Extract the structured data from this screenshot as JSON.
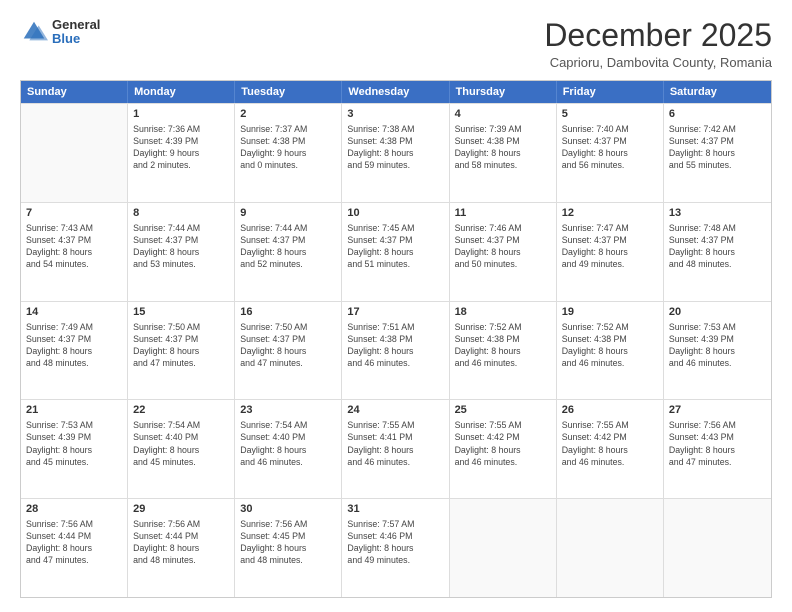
{
  "logo": {
    "general": "General",
    "blue": "Blue"
  },
  "header": {
    "month": "December 2025",
    "location": "Caprioru, Dambovita County, Romania"
  },
  "days": [
    "Sunday",
    "Monday",
    "Tuesday",
    "Wednesday",
    "Thursday",
    "Friday",
    "Saturday"
  ],
  "weeks": [
    [
      {
        "date": "",
        "info": ""
      },
      {
        "date": "1",
        "info": "Sunrise: 7:36 AM\nSunset: 4:39 PM\nDaylight: 9 hours\nand 2 minutes."
      },
      {
        "date": "2",
        "info": "Sunrise: 7:37 AM\nSunset: 4:38 PM\nDaylight: 9 hours\nand 0 minutes."
      },
      {
        "date": "3",
        "info": "Sunrise: 7:38 AM\nSunset: 4:38 PM\nDaylight: 8 hours\nand 59 minutes."
      },
      {
        "date": "4",
        "info": "Sunrise: 7:39 AM\nSunset: 4:38 PM\nDaylight: 8 hours\nand 58 minutes."
      },
      {
        "date": "5",
        "info": "Sunrise: 7:40 AM\nSunset: 4:37 PM\nDaylight: 8 hours\nand 56 minutes."
      },
      {
        "date": "6",
        "info": "Sunrise: 7:42 AM\nSunset: 4:37 PM\nDaylight: 8 hours\nand 55 minutes."
      }
    ],
    [
      {
        "date": "7",
        "info": "Sunrise: 7:43 AM\nSunset: 4:37 PM\nDaylight: 8 hours\nand 54 minutes."
      },
      {
        "date": "8",
        "info": "Sunrise: 7:44 AM\nSunset: 4:37 PM\nDaylight: 8 hours\nand 53 minutes."
      },
      {
        "date": "9",
        "info": "Sunrise: 7:44 AM\nSunset: 4:37 PM\nDaylight: 8 hours\nand 52 minutes."
      },
      {
        "date": "10",
        "info": "Sunrise: 7:45 AM\nSunset: 4:37 PM\nDaylight: 8 hours\nand 51 minutes."
      },
      {
        "date": "11",
        "info": "Sunrise: 7:46 AM\nSunset: 4:37 PM\nDaylight: 8 hours\nand 50 minutes."
      },
      {
        "date": "12",
        "info": "Sunrise: 7:47 AM\nSunset: 4:37 PM\nDaylight: 8 hours\nand 49 minutes."
      },
      {
        "date": "13",
        "info": "Sunrise: 7:48 AM\nSunset: 4:37 PM\nDaylight: 8 hours\nand 48 minutes."
      }
    ],
    [
      {
        "date": "14",
        "info": "Sunrise: 7:49 AM\nSunset: 4:37 PM\nDaylight: 8 hours\nand 48 minutes."
      },
      {
        "date": "15",
        "info": "Sunrise: 7:50 AM\nSunset: 4:37 PM\nDaylight: 8 hours\nand 47 minutes."
      },
      {
        "date": "16",
        "info": "Sunrise: 7:50 AM\nSunset: 4:37 PM\nDaylight: 8 hours\nand 47 minutes."
      },
      {
        "date": "17",
        "info": "Sunrise: 7:51 AM\nSunset: 4:38 PM\nDaylight: 8 hours\nand 46 minutes."
      },
      {
        "date": "18",
        "info": "Sunrise: 7:52 AM\nSunset: 4:38 PM\nDaylight: 8 hours\nand 46 minutes."
      },
      {
        "date": "19",
        "info": "Sunrise: 7:52 AM\nSunset: 4:38 PM\nDaylight: 8 hours\nand 46 minutes."
      },
      {
        "date": "20",
        "info": "Sunrise: 7:53 AM\nSunset: 4:39 PM\nDaylight: 8 hours\nand 46 minutes."
      }
    ],
    [
      {
        "date": "21",
        "info": "Sunrise: 7:53 AM\nSunset: 4:39 PM\nDaylight: 8 hours\nand 45 minutes."
      },
      {
        "date": "22",
        "info": "Sunrise: 7:54 AM\nSunset: 4:40 PM\nDaylight: 8 hours\nand 45 minutes."
      },
      {
        "date": "23",
        "info": "Sunrise: 7:54 AM\nSunset: 4:40 PM\nDaylight: 8 hours\nand 46 minutes."
      },
      {
        "date": "24",
        "info": "Sunrise: 7:55 AM\nSunset: 4:41 PM\nDaylight: 8 hours\nand 46 minutes."
      },
      {
        "date": "25",
        "info": "Sunrise: 7:55 AM\nSunset: 4:42 PM\nDaylight: 8 hours\nand 46 minutes."
      },
      {
        "date": "26",
        "info": "Sunrise: 7:55 AM\nSunset: 4:42 PM\nDaylight: 8 hours\nand 46 minutes."
      },
      {
        "date": "27",
        "info": "Sunrise: 7:56 AM\nSunset: 4:43 PM\nDaylight: 8 hours\nand 47 minutes."
      }
    ],
    [
      {
        "date": "28",
        "info": "Sunrise: 7:56 AM\nSunset: 4:44 PM\nDaylight: 8 hours\nand 47 minutes."
      },
      {
        "date": "29",
        "info": "Sunrise: 7:56 AM\nSunset: 4:44 PM\nDaylight: 8 hours\nand 48 minutes."
      },
      {
        "date": "30",
        "info": "Sunrise: 7:56 AM\nSunset: 4:45 PM\nDaylight: 8 hours\nand 48 minutes."
      },
      {
        "date": "31",
        "info": "Sunrise: 7:57 AM\nSunset: 4:46 PM\nDaylight: 8 hours\nand 49 minutes."
      },
      {
        "date": "",
        "info": ""
      },
      {
        "date": "",
        "info": ""
      },
      {
        "date": "",
        "info": ""
      }
    ]
  ]
}
